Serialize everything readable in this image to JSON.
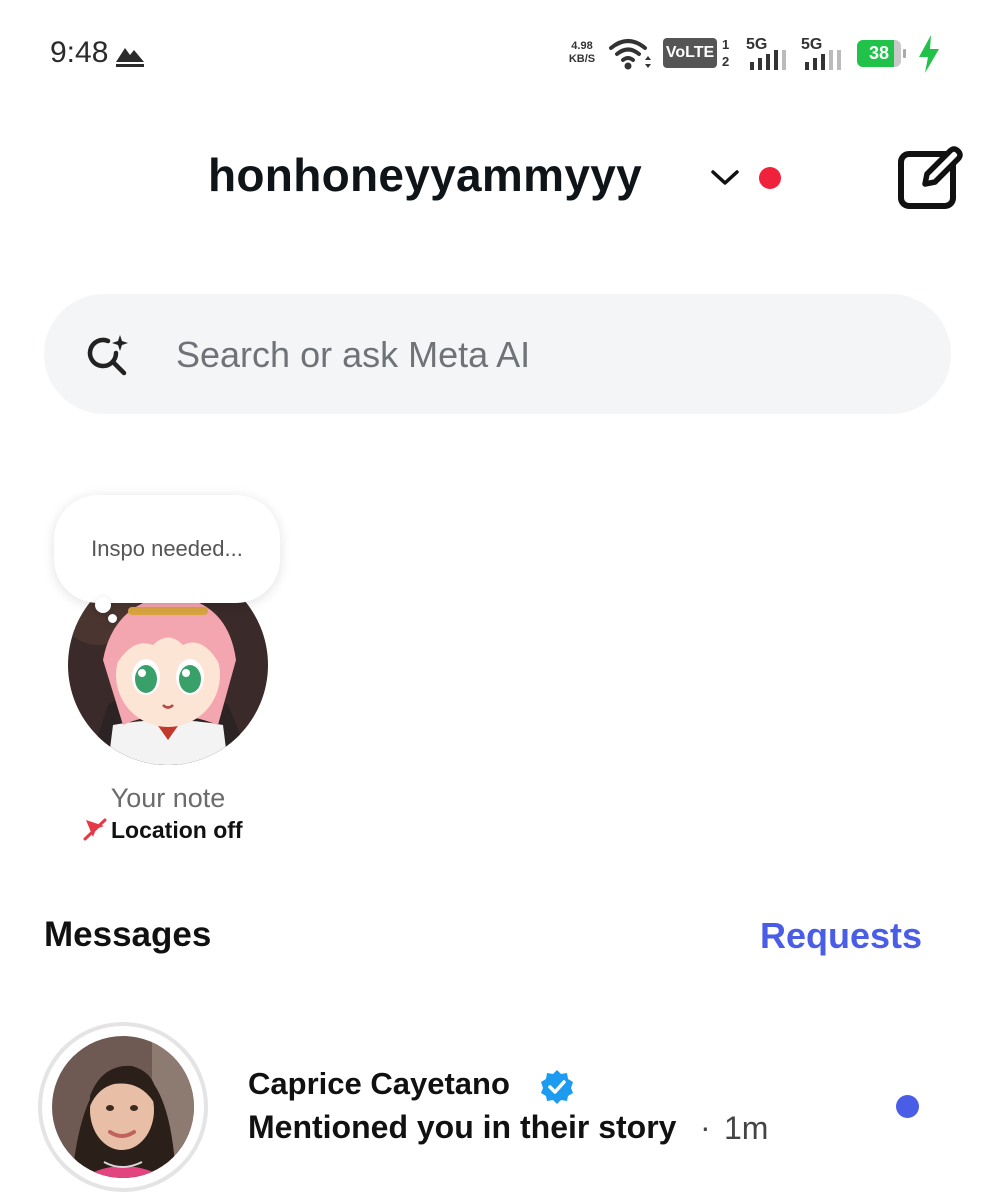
{
  "status_bar": {
    "time": "9:48",
    "speed_value": "4.98",
    "speed_unit": "KB/S",
    "volte": "VoLTE",
    "sim_top": "1",
    "sim_bottom": "2",
    "net1": "5G",
    "net2": "5G",
    "battery": "38",
    "battery_level": 0.38,
    "icons": [
      "mountain-icon",
      "wifi-icon",
      "signal-icon",
      "battery-icon",
      "charging-bolt-icon"
    ]
  },
  "header": {
    "username": "honhoneyyammyyy",
    "icons": [
      "chevron-down-icon",
      "compose-icon"
    ],
    "status_color": "#f0213a"
  },
  "search": {
    "placeholder": "Search or ask Meta AI",
    "value": "",
    "icon": "meta-ai-search-icon"
  },
  "note": {
    "bubble_text": "Inspo needed...",
    "label": "Your note",
    "location_text": "Location off",
    "location_icon": "location-off-icon"
  },
  "messages": {
    "title": "Messages",
    "requests": "Requests",
    "accent": "#4a5de6"
  },
  "threads": [
    {
      "name": "Caprice Cayetano",
      "verified": true,
      "preview": "Mentioned you in their story",
      "separator": "·",
      "time": "1m",
      "unread": true
    }
  ]
}
